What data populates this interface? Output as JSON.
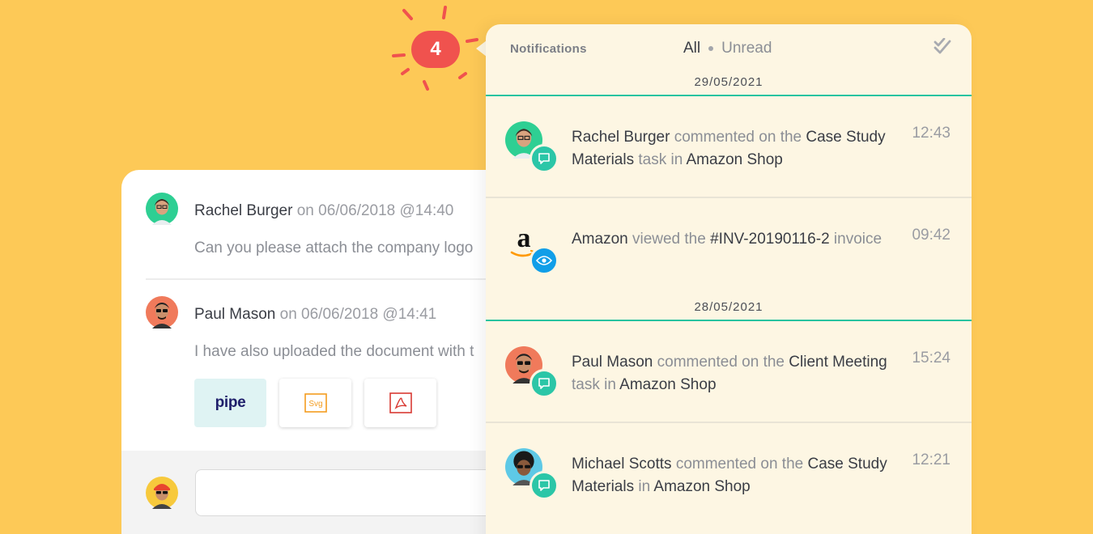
{
  "comments": [
    {
      "author": "Rachel Burger",
      "meta": "on 06/06/2018 @14:40",
      "body": "Can you please attach the company logo"
    },
    {
      "author": "Paul Mason",
      "meta": "on 06/06/2018 @14:41",
      "body": "I have also uploaded the document with t"
    }
  ],
  "attachments": [
    {
      "kind": "pipe",
      "label": "pipe"
    },
    {
      "kind": "svg",
      "label": "Svg"
    },
    {
      "kind": "pdf",
      "label": ""
    }
  ],
  "badge": {
    "count": "4"
  },
  "notifications": {
    "title": "Notifications",
    "filter_all": "All",
    "filter_unread": "Unread",
    "groups": [
      {
        "date": "29/05/2021",
        "items": [
          {
            "parts": [
              "Rachel Burger",
              " commented on the ",
              "Case Study Materials",
              " task in ",
              "Amazon Shop"
            ],
            "time": "12:43",
            "overlay": "comment-icon"
          },
          {
            "parts": [
              "Amazon",
              " viewed the ",
              "#INV-20190116-2",
              " invoice"
            ],
            "time": "09:42",
            "overlay": "eye-icon"
          }
        ]
      },
      {
        "date": "28/05/2021",
        "items": [
          {
            "parts": [
              "Paul Mason",
              " commented on the ",
              "Client Meeting",
              " task in ",
              "Amazon Shop"
            ],
            "time": "15:24",
            "overlay": "comment-icon"
          },
          {
            "parts": [
              "Michael Scotts",
              " commented on the ",
              "Case Study Materials",
              " in ",
              "Amazon Shop"
            ],
            "time": "12:21",
            "overlay": "comment-icon"
          }
        ]
      }
    ]
  },
  "colors": {
    "background": "#fdc957",
    "badge": "#f0524e",
    "accent_teal": "#28c3a0",
    "view_blue": "#119ee8"
  }
}
